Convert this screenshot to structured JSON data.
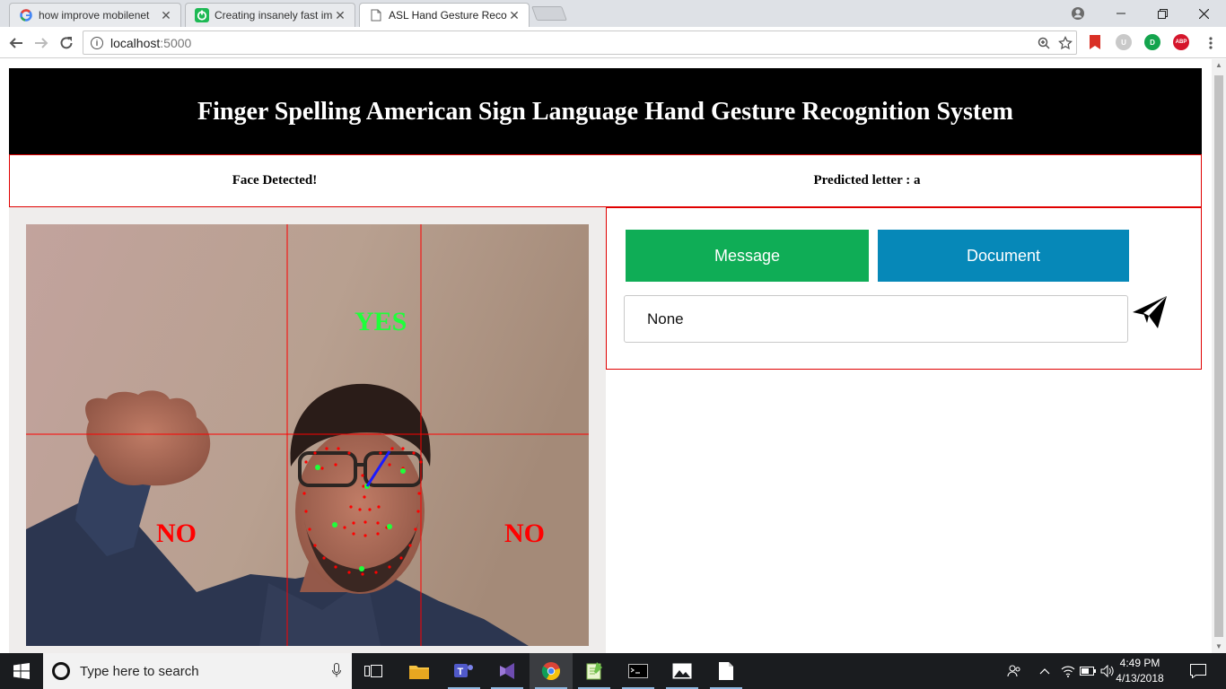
{
  "browser": {
    "tabs": [
      {
        "title": "how improve mobilenet",
        "icon": "google-icon",
        "active": false
      },
      {
        "title": "Creating insanely fast ima",
        "icon": "power-icon",
        "active": false
      },
      {
        "title": "ASL Hand Gesture Recog",
        "icon": "document-icon",
        "active": true
      }
    ],
    "close_glyph": "✕",
    "address": {
      "host": "localhost",
      "port": ":5000"
    },
    "extensions": [
      {
        "name": "bookmark-ext-icon",
        "label": "",
        "color": "#d93025"
      },
      {
        "name": "ublock-ext-icon",
        "label": "U",
        "color": "#c9c9c9"
      },
      {
        "name": "green-ext-icon",
        "label": "D",
        "color": "#14a44d"
      },
      {
        "name": "adblock-ext-icon",
        "label": "ABP",
        "color": "#d5152b"
      }
    ]
  },
  "page": {
    "header_title": "Finger Spelling American Sign Language Hand Gesture Recognition System",
    "face_status": "Face Detected!",
    "predicted_label": "Predicted letter : a",
    "webcam": {
      "label_yes": "YES",
      "label_no_left": "NO",
      "label_no_right": "NO",
      "yes_color": "#1fff3a",
      "no_color": "#ff0000",
      "grid_color": "#ff0000"
    },
    "buttons": {
      "message": "Message",
      "document": "Document",
      "message_color": "#0fad56",
      "document_color": "#0688b8"
    },
    "input_value": "None"
  },
  "taskbar": {
    "search_placeholder": "Type here to search",
    "time": "4:49 PM",
    "date": "4/13/2018"
  }
}
